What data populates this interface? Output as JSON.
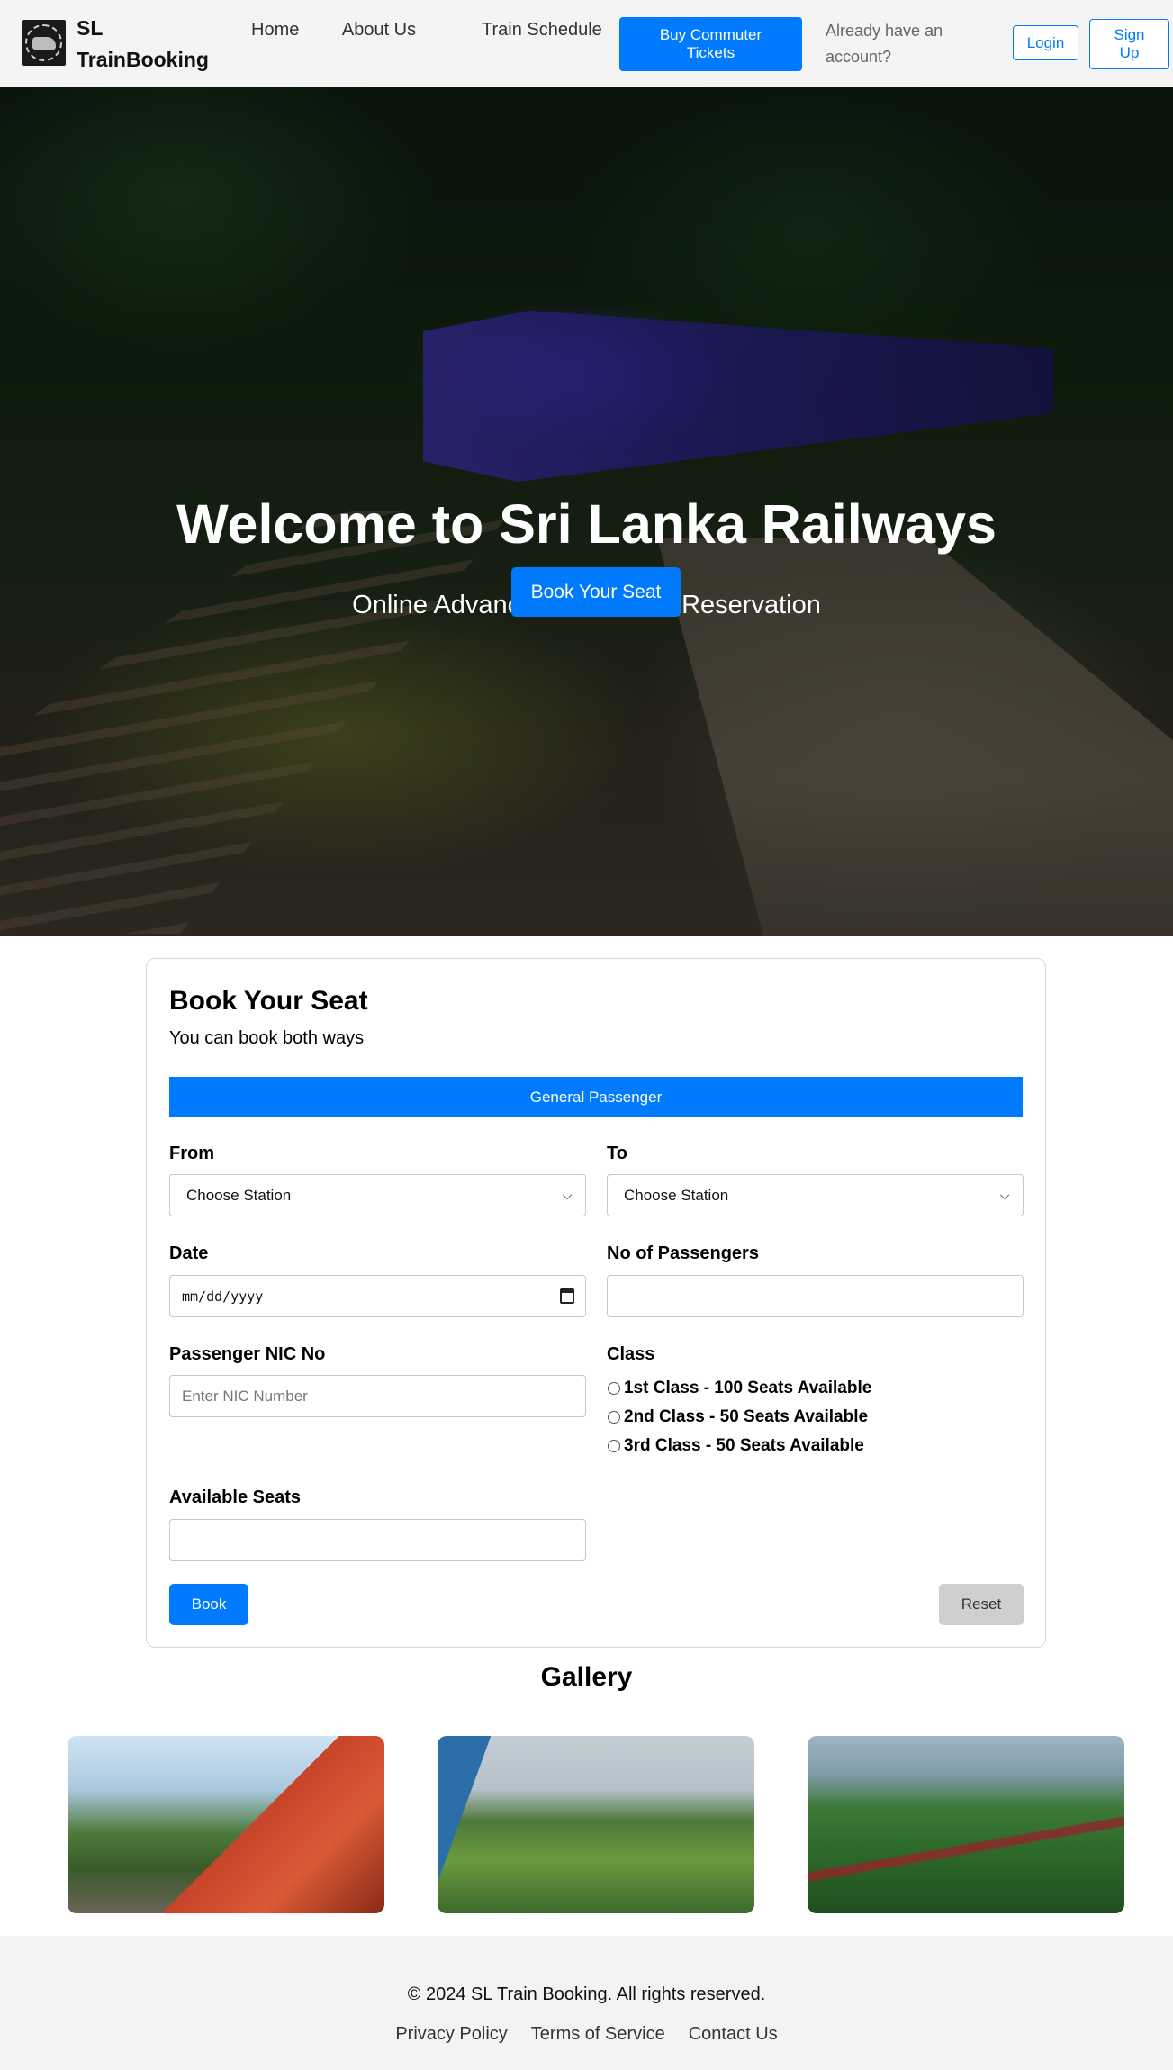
{
  "navbar": {
    "brand": "SL TrainBooking",
    "links": [
      "Home",
      "About Us",
      "Train Schedule"
    ],
    "commuter_button": "Buy Commuter Tickets",
    "account_prompt": "Already have an account?",
    "login_button": "Login",
    "signup_button": "Sign Up"
  },
  "hero": {
    "title": "Welcome to Sri Lanka Railways",
    "subtitle": "Online Advance Train Seats Reservation",
    "cta_button": "Book Your Seat"
  },
  "booking": {
    "title": "Book Your Seat",
    "subtitle": "You can book both ways",
    "passenger_type": "General Passenger",
    "from_label": "From",
    "from_value": "Choose Station",
    "to_label": "To",
    "to_value": "Choose Station",
    "date_label": "Date",
    "date_placeholder": "mm/dd/yyyy",
    "passengers_label": "No of Passengers",
    "passengers_value": "",
    "nic_label": "Passenger NIC No",
    "nic_placeholder": "Enter NIC Number",
    "class_label": "Class",
    "class_options": [
      "1st Class - 100 Seats Available",
      "2nd Class - 50 Seats Available",
      "3rd Class - 50 Seats Available"
    ],
    "available_seats_label": "Available Seats",
    "available_seats_value": "",
    "book_button": "Book",
    "reset_button": "Reset"
  },
  "gallery": {
    "title": "Gallery",
    "images": [
      "train-side-window-image",
      "tea-estate-train-image",
      "nine-arch-bridge-image"
    ]
  },
  "footer": {
    "copyright": "© 2024 SL Train Booking. All rights reserved.",
    "links": [
      "Privacy Policy",
      "Terms of Service",
      "Contact Us"
    ]
  },
  "colors": {
    "primary": "#007bff",
    "navbar_bg": "#f4f4f4",
    "footer_bg": "#f3f3f3",
    "reset_bg": "#cfcfcf"
  }
}
